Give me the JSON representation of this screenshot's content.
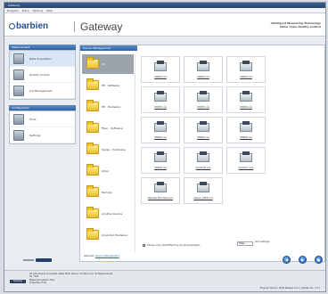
{
  "window": {
    "title": "Gateway"
  },
  "menu": [
    "Program",
    "Store",
    "Options",
    "Help"
  ],
  "header": {
    "brand": "barbien",
    "app_name": "Gateway",
    "tagline_1": "Intelligent Measuring Technology",
    "tagline_2": "Inline Color Quality Control"
  },
  "sidebar": {
    "head1": "Measurement",
    "items1": [
      "Data Acquisition",
      "Quality Control",
      "Job Management"
    ],
    "head2": "Configuration",
    "items2": [
      "Tools",
      "Settings"
    ]
  },
  "main": {
    "head": "Device Management",
    "folders": [
      "All",
      "EP - Software",
      "EP - Hardware",
      "Fiber - Software",
      "Spoke - Hardware",
      "Older",
      "Remote",
      "Another Device",
      "Unsorted Hardware"
    ],
    "tiles": [
      "CSE62.vca",
      "CSE62.vca",
      "CSE62.vca",
      "CSE63.vca",
      "CSE63.vca",
      "CSE64.vca",
      "CSE65.vca",
      "CSE65.vca",
      "CSE68.vca",
      "CSE66.vca",
      "Series70.vca",
      "Series71.vca",
      "Remote Standard.vca",
      "Series_CSE3.vca"
    ],
    "show_all": "Show only identified by product/system",
    "filter": "Filter…",
    "sort": "Sort settings",
    "bread_label": "Selected:",
    "bread_link": "Device Management"
  },
  "nav": {
    "back": "◀",
    "next": "▶",
    "home": "●"
  },
  "status": {
    "logo": "Gateway",
    "line1": "All Instruments Accessible: Read Write Device Conditions for all Measurement",
    "line2": "ID: 7320",
    "line3": "Measured system: Fiber",
    "line4": "Properties: Kind",
    "right": "Program Version: 2009 Release 2.0.1  |  Update Ver. 3.0.1"
  },
  "colors": {
    "accent": "#2f63a7",
    "folder": "#f0c230"
  }
}
